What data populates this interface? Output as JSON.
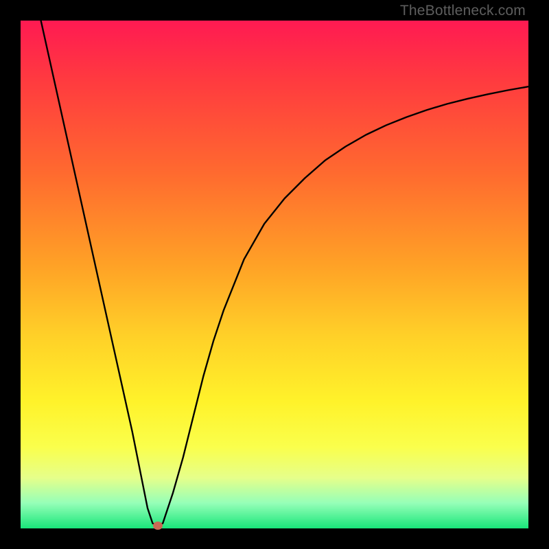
{
  "watermark": "TheBottleneck.com",
  "chart_data": {
    "type": "line",
    "title": "",
    "xlabel": "",
    "ylabel": "",
    "xlim": [
      0,
      100
    ],
    "ylim": [
      0,
      100
    ],
    "series": [
      {
        "name": "bottleneck-curve",
        "x": [
          4,
          6,
          8,
          10,
          12,
          14,
          16,
          18,
          20,
          22,
          23,
          24,
          25,
          26,
          27,
          28,
          30,
          32,
          34,
          36,
          38,
          40,
          44,
          48,
          52,
          56,
          60,
          64,
          68,
          72,
          76,
          80,
          84,
          88,
          92,
          96,
          100
        ],
        "y": [
          100,
          91,
          82,
          73,
          64,
          55,
          46,
          37,
          28,
          19,
          14,
          9,
          4,
          1,
          0.5,
          1,
          7,
          14,
          22,
          30,
          37,
          43,
          53,
          60,
          65,
          69,
          72.5,
          75.2,
          77.5,
          79.4,
          81,
          82.4,
          83.6,
          84.6,
          85.5,
          86.3,
          87
        ]
      }
    ],
    "minimum_marker": {
      "x": 27,
      "y": 0.5
    },
    "gradient_colors": {
      "top": "#ff1a52",
      "mid_high": "#ffa126",
      "mid_low": "#fff22a",
      "bottom": "#18e67a"
    }
  }
}
